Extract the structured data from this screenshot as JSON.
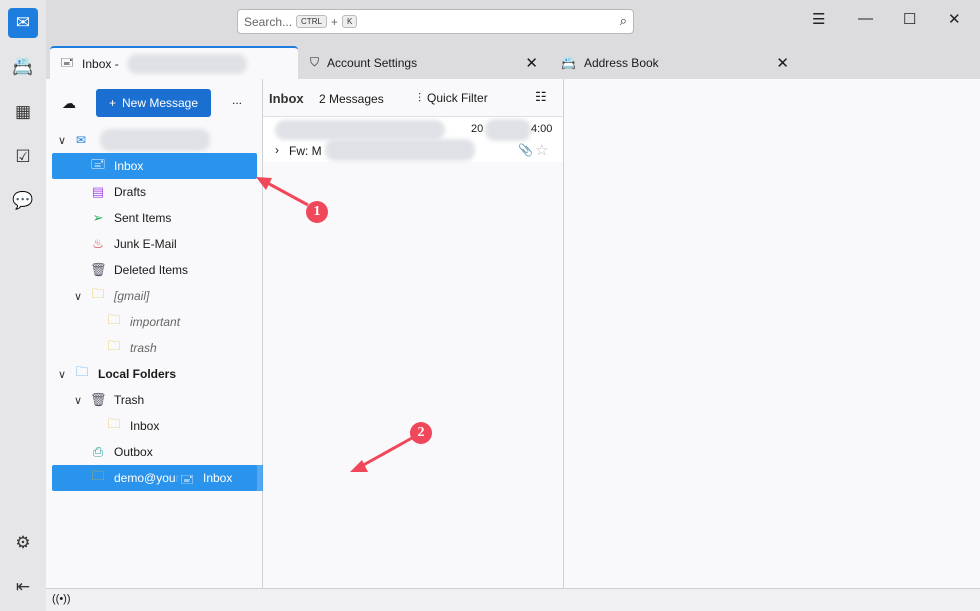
{
  "search": {
    "placeholder": "Search...",
    "shortcut_mod": "CTRL",
    "plus": "+",
    "shortcut_key": "K"
  },
  "tabs": [
    {
      "label": "Inbox - "
    },
    {
      "label": "Account Settings"
    },
    {
      "label": "Address Book"
    }
  ],
  "folder_pane": {
    "new_message": "New Message",
    "more": "...",
    "folders": [
      {
        "label": "Inbox",
        "icon": "inbox-icon"
      },
      {
        "label": "Drafts",
        "icon": "drafts-icon"
      },
      {
        "label": "Sent Items",
        "icon": "sent-icon"
      },
      {
        "label": "Junk E-Mail",
        "icon": "junk-icon"
      },
      {
        "label": "Deleted Items",
        "icon": "trash-icon"
      },
      {
        "label": "[gmail]",
        "icon": "folder-icon"
      },
      {
        "label": "important",
        "icon": "folder-icon"
      },
      {
        "label": "trash",
        "icon": "folder-icon"
      },
      {
        "label": "Local Folders",
        "icon": "folder-icon"
      },
      {
        "label": "Trash",
        "icon": "trash-icon"
      },
      {
        "label": "Inbox",
        "icon": "folder-icon"
      },
      {
        "label": "Outbox",
        "icon": "outbox-icon"
      },
      {
        "label": "demo@your",
        "icon": "folder-icon"
      }
    ],
    "drag_ghost": "Inbox"
  },
  "message_list": {
    "title": "Inbox",
    "count": "2 Messages",
    "quick_filter": "Quick Filter",
    "messages": [
      {
        "date_prefix": "20",
        "date_suffix": "4:00",
        "subject": "Fw: M"
      }
    ]
  },
  "annotations": [
    "1",
    "2"
  ],
  "colors": {
    "accent": "#1e7ee0",
    "selection": "#2a93ec",
    "annotation": "#f0485a"
  }
}
